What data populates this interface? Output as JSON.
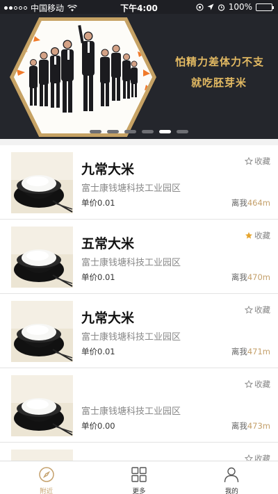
{
  "status_bar": {
    "carrier": "中国移动",
    "time": "下午4:00",
    "battery": "100%",
    "battery_level": 1.0
  },
  "banner": {
    "slogan_line1": "怕精力差体力不支",
    "slogan_line2": "就吃胚芽米",
    "pages": 6,
    "active_page": 4
  },
  "labels": {
    "favorite": "收藏",
    "price_prefix": "单价",
    "distance_prefix": "离我"
  },
  "items": [
    {
      "name": "九常大米",
      "address": "富士康钱塘科技工业园区",
      "price": "0.01",
      "distance": "464m",
      "favorited": false
    },
    {
      "name": "五常大米",
      "address": "富士康钱塘科技工业园区",
      "price": "0.01",
      "distance": "470m",
      "favorited": true
    },
    {
      "name": "九常大米",
      "address": "富士康钱塘科技工业园区",
      "price": "0.01",
      "distance": "471m",
      "favorited": false
    },
    {
      "name": "",
      "address": "富士康钱塘科技工业园区",
      "price": "0.00",
      "distance": "473m",
      "favorited": false
    },
    {
      "name": "",
      "address": "",
      "price": "",
      "distance": "",
      "favorited": false
    }
  ],
  "tabs": [
    {
      "label": "附近",
      "icon": "compass-icon",
      "active": true
    },
    {
      "label": "更多",
      "icon": "grid-icon",
      "active": false
    },
    {
      "label": "我的",
      "icon": "user-icon",
      "active": false
    }
  ],
  "colors": {
    "accent": "#c4a06b",
    "banner_bg": "#24262c",
    "slogan": "#e2b962",
    "star_active": "#e6a52e"
  }
}
